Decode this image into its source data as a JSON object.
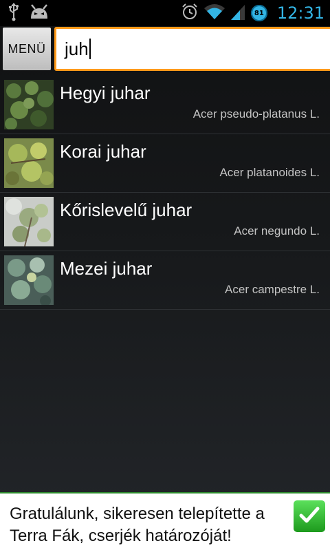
{
  "status_bar": {
    "time": "12:31",
    "battery_level": "81",
    "icons": [
      "usb-icon",
      "android-debug-icon",
      "alarm-icon",
      "wifi-icon",
      "signal-icon",
      "battery-icon"
    ]
  },
  "header": {
    "menu_label": "MENÜ",
    "search_value": "juh"
  },
  "results": [
    {
      "name": "Hegyi juhar",
      "latin": "Acer pseudo-platanus L."
    },
    {
      "name": "Korai juhar",
      "latin": "Acer platanoides L."
    },
    {
      "name": "Kőrislevelű juhar",
      "latin": "Acer negundo L."
    },
    {
      "name": "Mezei juhar",
      "latin": "Acer campestre L."
    }
  ],
  "banner": {
    "message": "Gratulálunk, sikeresen telepítette a Terra Fák, cserjék határozóját!"
  },
  "colors": {
    "accent": "#33b5e5",
    "search_border": "#ff9a1a",
    "ok_green": "#2fbf2f"
  }
}
